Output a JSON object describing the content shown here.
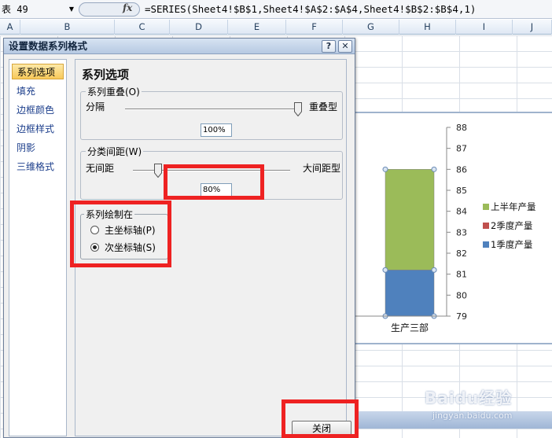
{
  "formula_bar": {
    "name_box": "表 49",
    "fx_label": "fx",
    "formula": "=SERIES(Sheet4!$B$1,Sheet4!$A$2:$A$4,Sheet4!$B$2:$B$4,1)"
  },
  "columns": [
    "A",
    "B",
    "C",
    "D",
    "E",
    "F",
    "G",
    "H",
    "I",
    "J"
  ],
  "dialog": {
    "title": "设置数据系列格式",
    "help_label": "?",
    "close_label": "✕",
    "nav": [
      "系列选项",
      "填充",
      "边框颜色",
      "边框样式",
      "阴影",
      "三维格式"
    ],
    "selected_nav": "系列选项",
    "section_title": "系列选项",
    "overlap": {
      "legend": "系列重叠(O)",
      "left_label": "分隔",
      "right_label": "重叠型",
      "value": "100%",
      "level": 1.0
    },
    "gap_width": {
      "legend": "分类间距(W)",
      "left_label": "无间距",
      "right_label": "大间距型",
      "value": "80%",
      "level": 0.16
    },
    "plot_on": {
      "legend": "系列绘制在",
      "primary_label": "主坐标轴(P)",
      "secondary_label": "次坐标轴(S)",
      "selected": "secondary"
    },
    "close_button": "关闭"
  },
  "chart_data": {
    "type": "bar",
    "stacked": true,
    "categories": [
      "生产三部"
    ],
    "series": [
      {
        "name": "1季度产量",
        "values": [
          2.2
        ],
        "color": "#4f81bd"
      },
      {
        "name": "2季度产量",
        "values": [
          0
        ],
        "color": "#c0504d"
      },
      {
        "name": "上半年产量",
        "values": [
          4.8
        ],
        "color": "#9bbb59"
      }
    ],
    "baseline": 79,
    "ylim": [
      79,
      88
    ],
    "yticks": [
      "79",
      "80",
      "81",
      "82",
      "83",
      "84",
      "85",
      "86",
      "87",
      "88"
    ],
    "y_axis_side": "right",
    "legend": [
      "上半年产量",
      "2季度产量",
      "1季度产量"
    ],
    "legend_position": "right"
  },
  "colors": {
    "highlight": "#ee2222",
    "dialog_title_bg": "#c7d7ec",
    "selected_nav_bg": "#f8c95a"
  },
  "watermark": {
    "text": "Baidu经验",
    "url": "jingyan.baidu.com"
  }
}
